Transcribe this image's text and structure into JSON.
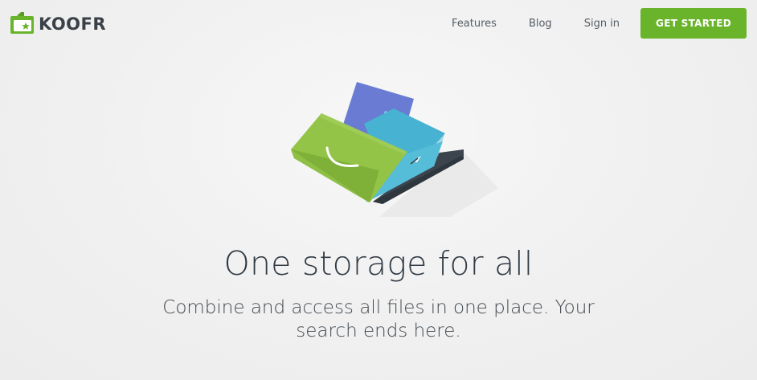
{
  "brand": {
    "name": "KOOFR",
    "accent_color": "#6ab42c",
    "logo_icon": "folder-star-icon"
  },
  "nav": {
    "items": [
      {
        "label": "Features"
      },
      {
        "label": "Blog"
      },
      {
        "label": "Sign in"
      }
    ],
    "cta_label": "GET STARTED"
  },
  "hero": {
    "illustration_icon": "storage-folder-illustration",
    "title": "One storage for all",
    "subtitle": "Combine and access all files in one place. Your search ends here."
  }
}
